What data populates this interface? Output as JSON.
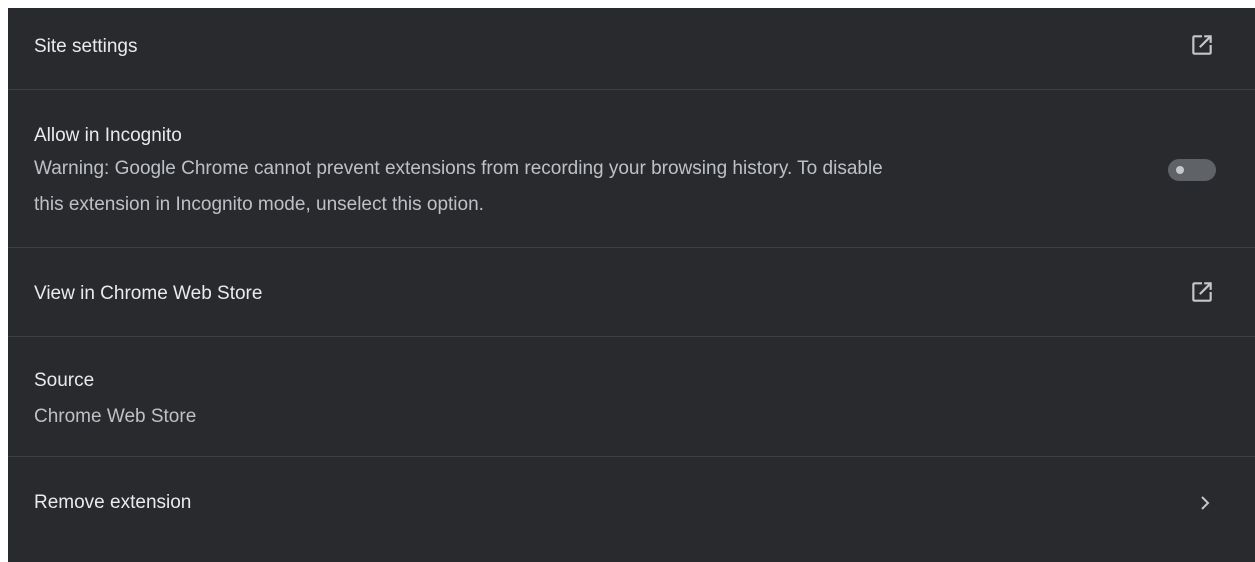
{
  "rows": {
    "site_settings": {
      "label": "Site settings",
      "icon": "open-in-new-icon"
    },
    "incognito": {
      "label": "Allow in Incognito",
      "description_line1": "Warning: Google Chrome cannot prevent extensions from recording your browsing history. To disable",
      "description_line2": "this extension in Incognito mode, unselect this option.",
      "toggle_on": false
    },
    "web_store": {
      "label": "View in Chrome Web Store",
      "icon": "open-in-new-icon"
    },
    "source": {
      "label": "Source",
      "value": "Chrome Web Store"
    },
    "remove": {
      "label": "Remove extension",
      "icon": "chevron-right-icon"
    }
  },
  "colors": {
    "background": "#292a2d",
    "text_primary": "#e8eaed",
    "text_secondary": "#bdc1c6",
    "divider": "#3f4042",
    "toggle_off_track": "#5f6368"
  }
}
